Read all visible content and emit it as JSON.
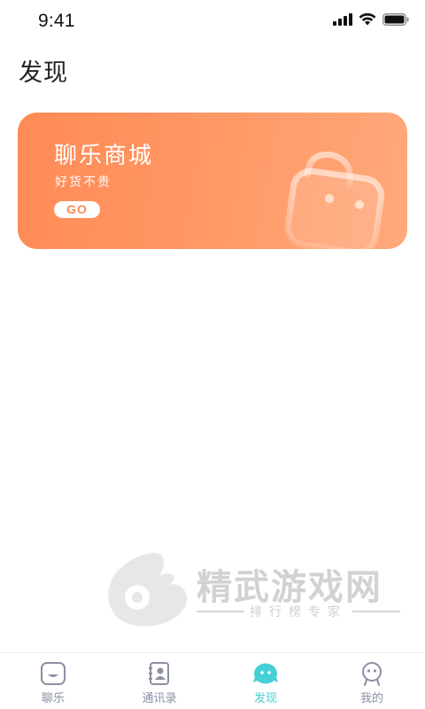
{
  "status_bar": {
    "time": "9:41",
    "icons": [
      "cellular-signal-icon",
      "wifi-icon",
      "battery-icon"
    ]
  },
  "page": {
    "title": "发现"
  },
  "mall_card": {
    "title": "聊乐商城",
    "subtitle": "好货不贵",
    "button_label": "GO",
    "icon": "shopping-bag-icon",
    "gradient_start": "#ff8a55",
    "gradient_end": "#ffa97b"
  },
  "watermark": {
    "title": "精武游戏网",
    "subtitle": "排行榜专家"
  },
  "tab_bar": {
    "accent_color": "#45cfd6",
    "inactive_color": "#8b90a3",
    "items": [
      {
        "label": "聊乐",
        "icon": "chat-icon",
        "active": false
      },
      {
        "label": "通讯录",
        "icon": "contacts-icon",
        "active": false
      },
      {
        "label": "发现",
        "icon": "discover-icon",
        "active": true
      },
      {
        "label": "我的",
        "icon": "profile-icon",
        "active": false
      }
    ]
  }
}
